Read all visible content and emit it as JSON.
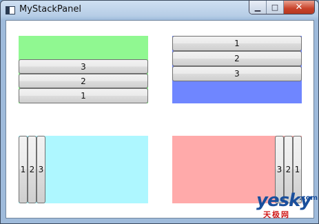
{
  "window": {
    "title": "MyStackPanel",
    "controls": {
      "minimize": "▁",
      "maximize": "□",
      "close": "✕"
    }
  },
  "panels": [
    {
      "name": "top-left",
      "fill": "#90f891",
      "orientation": "vertical-bottom",
      "buttons": [
        "3",
        "2",
        "1"
      ]
    },
    {
      "name": "top-right",
      "fill": "#6f86ff",
      "orientation": "vertical-top",
      "buttons": [
        "1",
        "2",
        "3"
      ]
    },
    {
      "name": "bottom-left",
      "fill": "#aef7ff",
      "orientation": "horizontal-left",
      "buttons": [
        "1",
        "2",
        "3"
      ]
    },
    {
      "name": "bottom-right",
      "fill": "#ffaaaa",
      "orientation": "horizontal-right",
      "buttons": [
        "3",
        "2",
        "1"
      ]
    }
  ],
  "watermark": {
    "logo": "yesky",
    "suffix": ".com",
    "cn": "天极网"
  }
}
